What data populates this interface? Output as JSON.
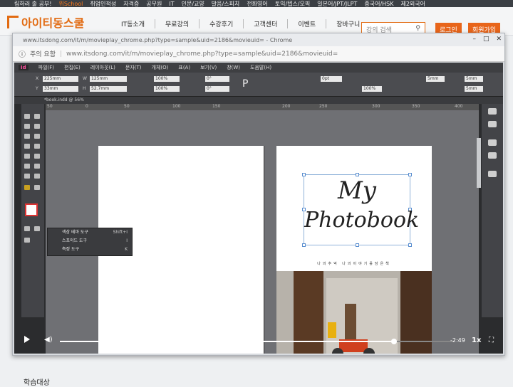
{
  "site": {
    "top_strip": [
      "림하러 출 공부!",
      "위School",
      "취업인적성",
      "자격증",
      "공무원",
      "IT",
      "인문/교양",
      "발음/스피치",
      "전화영어",
      "토익/텝스/오픽",
      "일본어/JPT/JLPT",
      "중국어/HSK",
      "제2외국어"
    ],
    "logo": "아이티동스쿨",
    "nav": [
      "IT동소개",
      "무료강의",
      "수강후기",
      "고객센터",
      "이벤트",
      "장바구니"
    ],
    "search_placeholder": "강의 검색",
    "login": "로그인",
    "signup": "회원가입",
    "below_text": "학습대상"
  },
  "browser": {
    "title": "www.itsdong.com/it/m/movieplay_chrome.php?type=sample&uid=2186&movieuid= - Chrome",
    "info": "주의 요함",
    "url": "www.itsdong.com/it/m/movieplay_chrome.php?type=sample&uid=2186&movieuid="
  },
  "indesign": {
    "logo": "Id",
    "menu": [
      "파일(F)",
      "편집(E)",
      "레이아웃(L)",
      "문자(T)",
      "개체(O)",
      "표(A)",
      "보기(V)",
      "창(W)",
      "도움말(H)"
    ],
    "x": "225mm",
    "y": "33mm",
    "w": "125mm",
    "h": "52.7mm",
    "scale1": "100%",
    "scale2": "100%",
    "angle": "0°",
    "shear": "0°",
    "stroke_w": "0pt",
    "opacity": "100%",
    "gap1": "5mm",
    "gap2": "5mm",
    "tab": "*book.indd @ 56%",
    "ruler": [
      "50",
      "0",
      "50",
      "100",
      "150",
      "200",
      "250",
      "300",
      "350",
      "400"
    ],
    "flyout": [
      {
        "label": "색상 테마 도구",
        "key": "Shift+I"
      },
      {
        "label": "스포이드 도구",
        "key": "I"
      },
      {
        "label": "측정 도구",
        "key": "K"
      }
    ],
    "doc_title_line1": "My",
    "doc_title_line2": "Photobook",
    "doc_subtitle": "나의추억 나의이야기를담은책"
  },
  "player": {
    "time": "-2:49",
    "speed": "1x",
    "progress": 0.85
  }
}
